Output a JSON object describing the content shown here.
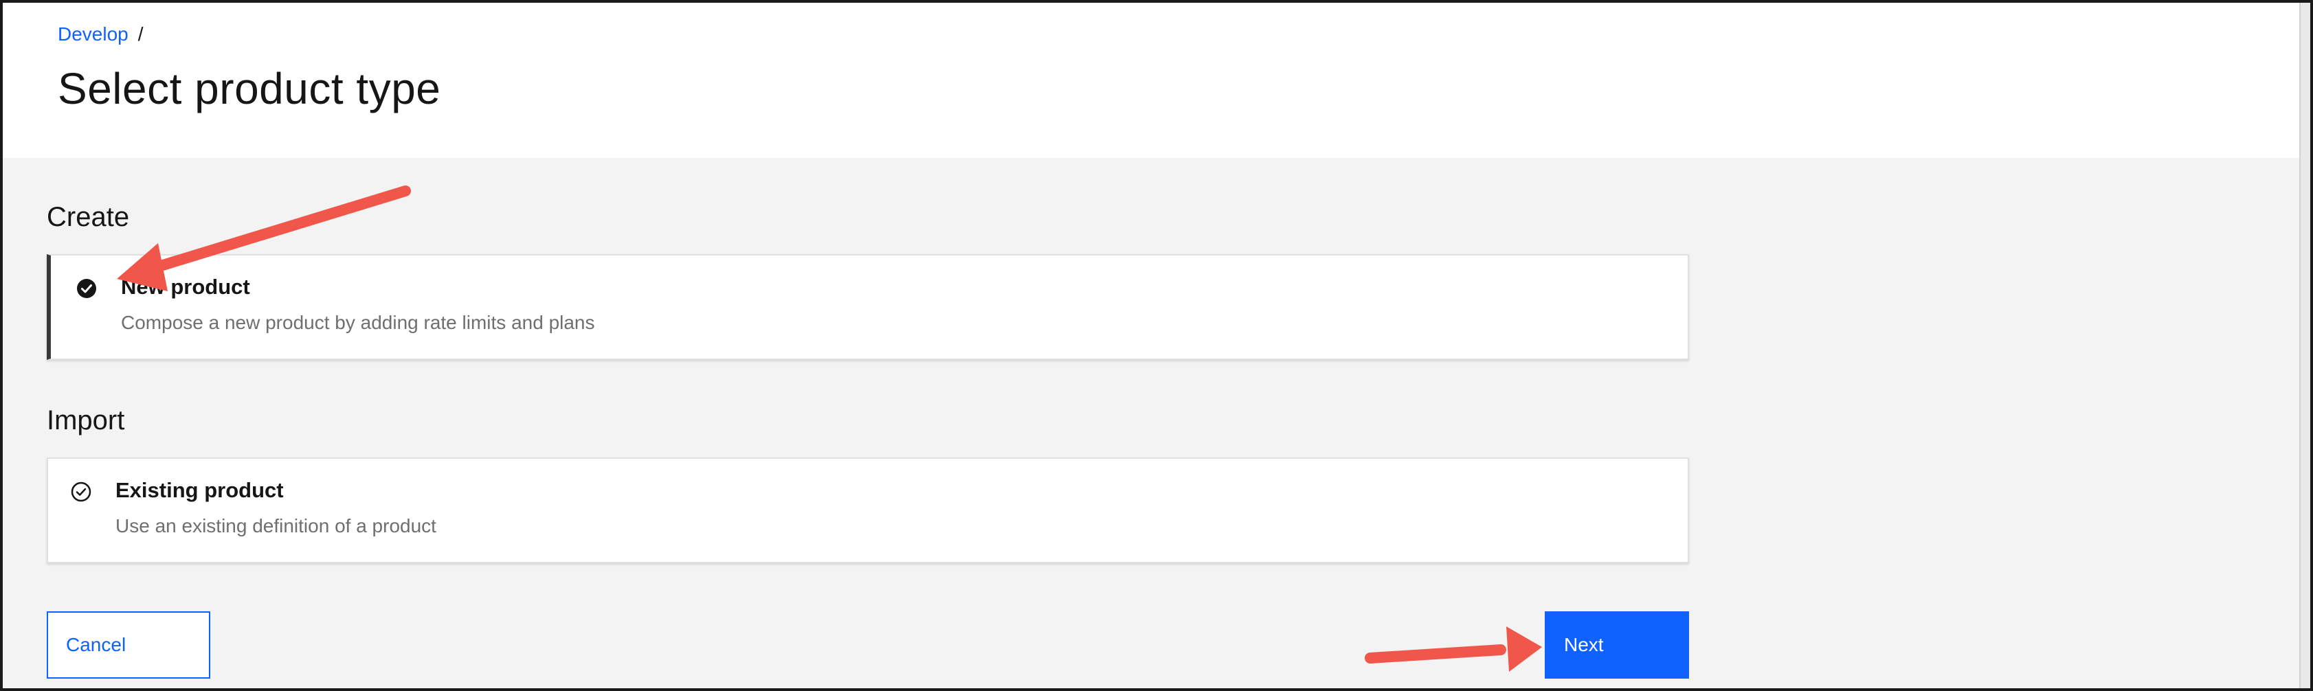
{
  "breadcrumb": {
    "link": "Develop",
    "separator": "/"
  },
  "page_title": "Select product type",
  "sections": {
    "create": {
      "heading": "Create",
      "tile": {
        "title": "New product",
        "description": "Compose a new product by adding rate limits and plans",
        "selected": true,
        "icon": "checkmark-filled-icon"
      }
    },
    "import": {
      "heading": "Import",
      "tile": {
        "title": "Existing product",
        "description": "Use an existing definition of a product",
        "selected": false,
        "icon": "checkmark-outline-icon"
      }
    }
  },
  "actions": {
    "cancel_label": "Cancel",
    "next_label": "Next"
  },
  "colors": {
    "accent": "#0f62fe",
    "annotation_arrow": "#f0564a",
    "content_bg": "#f3f3f3"
  }
}
